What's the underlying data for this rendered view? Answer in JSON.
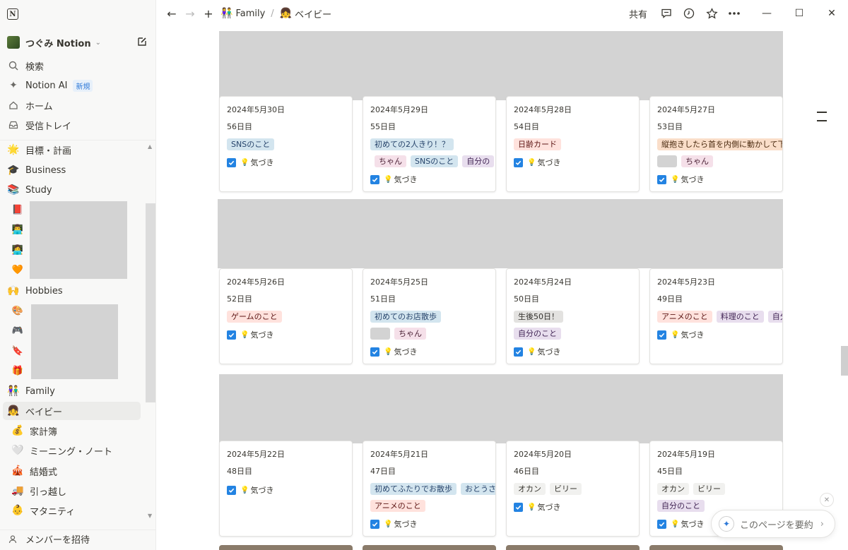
{
  "sidebar": {
    "workspace": "つぐみ Notion",
    "nav": [
      {
        "label": "検索",
        "icon": "search-icon"
      },
      {
        "label": "Notion AI",
        "icon": "sparkle-icon",
        "badge": "新規"
      },
      {
        "label": "ホーム",
        "icon": "home-icon"
      },
      {
        "label": "受信トレイ",
        "icon": "inbox-icon"
      }
    ],
    "pages": [
      {
        "label": "目標・計画",
        "emoji": "🌟"
      },
      {
        "label": "Business",
        "emoji": "🎓"
      },
      {
        "label": "Study",
        "emoji": "📚"
      },
      {
        "label": "Hobbies",
        "emoji": "🙌"
      },
      {
        "label": "Family",
        "emoji": "👫"
      },
      {
        "label": "ベイビー",
        "emoji": "👧"
      },
      {
        "label": "家計簿",
        "emoji": "💰"
      },
      {
        "label": "ミーニング・ノート",
        "emoji": "🤍"
      },
      {
        "label": "結婚式",
        "emoji": "🎪"
      },
      {
        "label": "引っ越し",
        "emoji": "🚚"
      },
      {
        "label": "マタニティ",
        "emoji": "👶"
      }
    ],
    "study_children": [
      "📕",
      "👨‍💻",
      "👩‍💻",
      "🧡"
    ],
    "hobby_children": [
      "🎨",
      "🎮",
      "🔖",
      "🎁"
    ],
    "invite": "メンバーを招待"
  },
  "topbar": {
    "breadcrumb_parent": "Family",
    "breadcrumb_parent_emoji": "👫",
    "breadcrumb_current": "ベイビー",
    "breadcrumb_current_emoji": "👧",
    "share": "共有"
  },
  "check_label": "気づき",
  "cards": [
    {
      "date": "2024年5月30日",
      "day": "56日目",
      "tags": [
        [
          {
            "t": "SNSのこと",
            "c": "blue"
          }
        ]
      ]
    },
    {
      "date": "2024年5月29日",
      "day": "55日目",
      "tags": [
        [
          {
            "t": "初めての2人きり！？",
            "c": "blue"
          }
        ],
        [
          {
            "t": "",
            "c": "redact-tag"
          },
          {
            "t": "ちゃん",
            "c": "pink"
          },
          {
            "t": "SNSのこと",
            "c": "blue"
          },
          {
            "t": "自分の",
            "c": "purple"
          }
        ]
      ]
    },
    {
      "date": "2024年5月28日",
      "day": "54日目",
      "tags": [
        [
          {
            "t": "日齢カード",
            "c": "red"
          }
        ]
      ]
    },
    {
      "date": "2024年5月27日",
      "day": "53日目",
      "tags": [
        [
          {
            "t": "縦抱きしたら首を内側に動かして下",
            "c": "orange"
          }
        ],
        [
          {
            "t": "",
            "c": "redact-tag"
          },
          {
            "t": "ちゃん",
            "c": "pink"
          }
        ]
      ]
    },
    {
      "date": "2024年5月26日",
      "day": "52日目",
      "tags": [
        [
          {
            "t": "ゲームのこと",
            "c": "red"
          }
        ]
      ]
    },
    {
      "date": "2024年5月25日",
      "day": "51日目",
      "tags": [
        [
          {
            "t": "初めてのお店散歩",
            "c": "blue"
          }
        ],
        [
          {
            "t": "",
            "c": "redact-tag"
          },
          {
            "t": "ちゃん",
            "c": "pink"
          }
        ]
      ]
    },
    {
      "date": "2024年5月24日",
      "day": "50日目",
      "tags": [
        [
          {
            "t": "生後50日！",
            "c": "gray"
          }
        ],
        [
          {
            "t": "自分のこと",
            "c": "purple"
          }
        ]
      ]
    },
    {
      "date": "2024年5月23日",
      "day": "49日目",
      "tags": [
        [
          {
            "t": "アニメのこと",
            "c": "red"
          },
          {
            "t": "料理のこと",
            "c": "purple"
          },
          {
            "t": "自分",
            "c": "purple"
          }
        ]
      ]
    },
    {
      "date": "2024年5月22日",
      "day": "48日目",
      "tags": []
    },
    {
      "date": "2024年5月21日",
      "day": "47日目",
      "tags": [
        [
          {
            "t": "初めてふたりでお散歩",
            "c": "blue"
          },
          {
            "t": "おとうさん",
            "c": "blue"
          }
        ],
        [
          {
            "t": "アニメのこと",
            "c": "red"
          }
        ]
      ]
    },
    {
      "date": "2024年5月20日",
      "day": "46日目",
      "tags": [
        [
          {
            "t": "オカン",
            "c": "plain"
          },
          {
            "t": "ビリー",
            "c": "plain"
          }
        ]
      ]
    },
    {
      "date": "2024年5月19日",
      "day": "45日目",
      "tags": [
        [
          {
            "t": "オカン",
            "c": "plain"
          },
          {
            "t": "ビリー",
            "c": "plain"
          }
        ],
        [
          {
            "t": "自分のこと",
            "c": "purple"
          }
        ]
      ]
    }
  ],
  "summary_button": "このページを要約",
  "colors": {
    "accent": "#2383e2",
    "sidebar_bg": "#f8f8f7"
  }
}
